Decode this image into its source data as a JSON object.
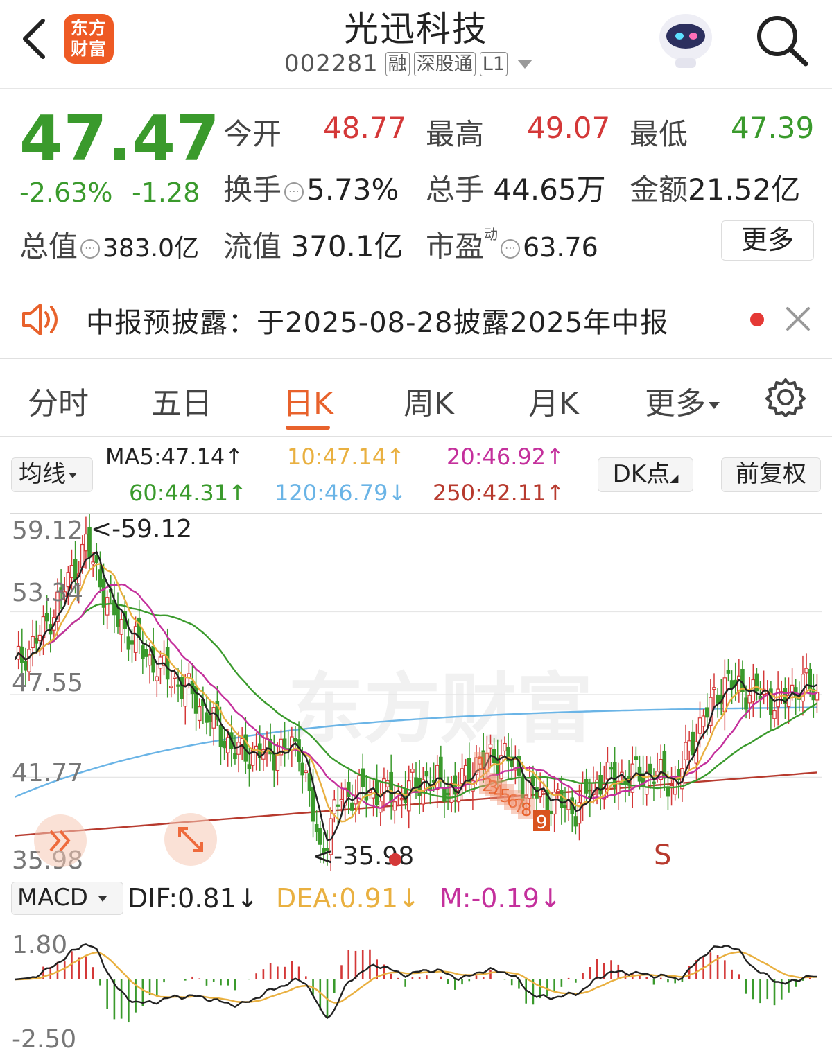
{
  "header": {
    "logo_line1": "东方",
    "logo_line2": "财富",
    "stock_name": "光迅科技",
    "stock_code": "002281",
    "tags": [
      "融",
      "深股通",
      "L1"
    ]
  },
  "quote": {
    "price": "47.47",
    "change_pct": "-2.63%",
    "change_abs": "-1.28",
    "open_label": "今开",
    "open": "48.77",
    "high_label": "最高",
    "high": "49.07",
    "low_label": "最低",
    "low": "47.39",
    "turnover_label": "换手",
    "turnover": "5.73%",
    "volume_label": "总手",
    "volume": "44.65万",
    "amount_label": "金额",
    "amount": "21.52亿",
    "mktcap_label": "总值",
    "mktcap": "383.0亿",
    "float_label": "流值",
    "float": "370.1亿",
    "pe_label": "市盈",
    "pe_sup": "动",
    "pe": "63.76",
    "more_label": "更多"
  },
  "notice": {
    "text": "中报预披露：于2025-08-28披露2025年中报"
  },
  "tabs": [
    {
      "label": "分时"
    },
    {
      "label": "五日"
    },
    {
      "label": "日K"
    },
    {
      "label": "周K"
    },
    {
      "label": "月K"
    },
    {
      "label": "更多"
    }
  ],
  "ma_bar": {
    "mode_label": "均线",
    "ma5": "MA5:47.14↑",
    "ma10": "10:47.14↑",
    "ma20": "20:46.92↑",
    "ma60": "60:44.31↑",
    "ma120": "120:46.79↓",
    "ma250": "250:42.11↑",
    "dk_label": "DK点",
    "adjust_label": "前复权"
  },
  "colors": {
    "up": "#d43838",
    "down": "#3a9a2c",
    "ma5": "#222222",
    "ma10": "#e9b040",
    "ma20": "#c4309c",
    "ma60": "#3a9a2c",
    "ma120": "#6ab4e6",
    "ma250": "#b73a2e",
    "accent": "#e8622c"
  },
  "kchart": {
    "y_labels": [
      "59.12",
      "53.34",
      "47.55",
      "41.77",
      "35.98"
    ],
    "max_annotation": "<-59.12",
    "min_annotation": "<-35.98",
    "signal": "S",
    "watermark": "东方财富",
    "nine_turn_labels": [
      "1",
      "2",
      "3",
      "4",
      "5",
      "6",
      "7",
      "8",
      "9"
    ]
  },
  "macd": {
    "mode_label": "MACD",
    "dif": "DIF:0.81↓",
    "dea": "DEA:0.91↓",
    "m": "M:-0.19↓",
    "y_top": "1.80",
    "y_bottom": "-2.50"
  }
}
